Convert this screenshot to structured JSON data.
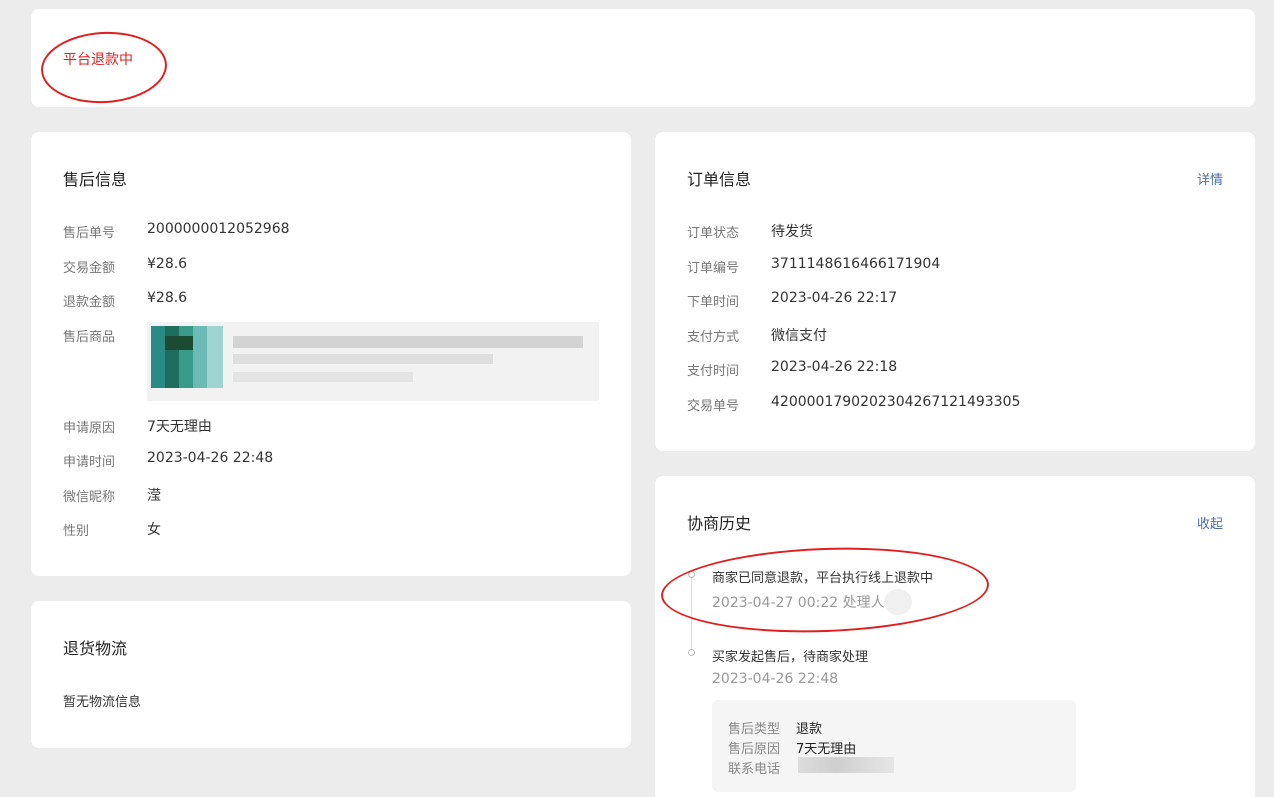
{
  "status": {
    "text": "平台退款中"
  },
  "aftersale": {
    "title": "售后信息",
    "rows": [
      {
        "label": "售后单号",
        "value": "2000000012052968"
      },
      {
        "label": "交易金额",
        "value": "¥28.6"
      },
      {
        "label": "退款金额",
        "value": "¥28.6"
      },
      {
        "label": "售后商品",
        "value": ""
      },
      {
        "label": "申请原因",
        "value": "7天无理由"
      },
      {
        "label": "申请时间",
        "value": "2023-04-26 22:48"
      },
      {
        "label": "微信昵称",
        "value": "滢"
      },
      {
        "label": "性别",
        "value": "女"
      }
    ]
  },
  "logistics": {
    "title": "退货物流",
    "empty_text": "暂无物流信息"
  },
  "order": {
    "title": "订单信息",
    "link": "详情",
    "rows": [
      {
        "label": "订单状态",
        "value": "待发货"
      },
      {
        "label": "订单编号",
        "value": "3711148616466171904"
      },
      {
        "label": "下单时间",
        "value": "2023-04-26 22:17"
      },
      {
        "label": "支付方式",
        "value": "微信支付"
      },
      {
        "label": "支付时间",
        "value": "2023-04-26 22:18"
      },
      {
        "label": "交易单号",
        "value": "4200001790202304267121493305"
      }
    ]
  },
  "history": {
    "title": "协商历史",
    "link": "收起",
    "events": [
      {
        "title": "商家已同意退款，平台执行线上退款中",
        "meta": "2023-04-27 00:22 处理人:"
      },
      {
        "title": "买家发起售后，待商家处理",
        "meta": "2023-04-26 22:48"
      }
    ],
    "details": [
      {
        "label": "售后类型",
        "value": "退款"
      },
      {
        "label": "售后原因",
        "value": "7天无理由"
      },
      {
        "label": "联系电话",
        "value": ""
      }
    ]
  },
  "colors": {
    "accent_red": "#e02020",
    "link_blue": "#4a6fa5",
    "background": "#ececec"
  }
}
